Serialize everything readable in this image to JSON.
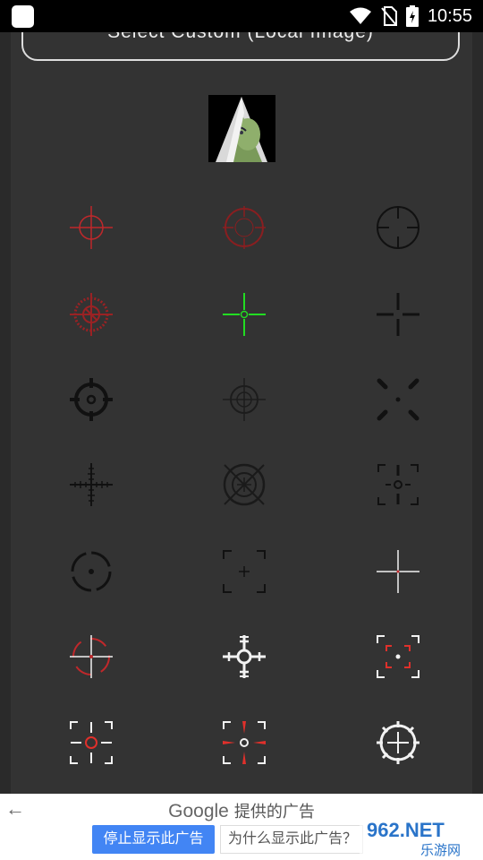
{
  "status_bar": {
    "time": "10:55"
  },
  "custom_button": {
    "label": "Select Custom (Local Image)"
  },
  "ad": {
    "provider": "Google",
    "title_suffix": "提供的广告",
    "stop_label": "停止显示此广告",
    "why_label": "为什么显示此广告？",
    "watermark": "962.NET",
    "watermark_sub": "乐游网"
  },
  "colors": {
    "red": "#c0282b",
    "green": "#22dd22",
    "black": "#111111",
    "white": "#f2f2f2",
    "panel": "#333333"
  },
  "crosshairs": [
    "red-thin-crosshair",
    "red-circle-dot",
    "black-circle-crosshair",
    "red-dotted-target",
    "green-crosshair",
    "black-plus-gap",
    "black-bold-circle-target",
    "dark-double-circle",
    "black-corner-dots",
    "black-ticked-plus",
    "black-circle-x",
    "black-bracket-dot",
    "black-dashed-circle-dot",
    "black-square-bracket-plus",
    "white-thin-cross",
    "white-red-scope",
    "white-heavy-reticle",
    "white-red-bracket",
    "white-red-circle-bracket",
    "white-red-arrow-bracket",
    "white-gear-reticle"
  ]
}
